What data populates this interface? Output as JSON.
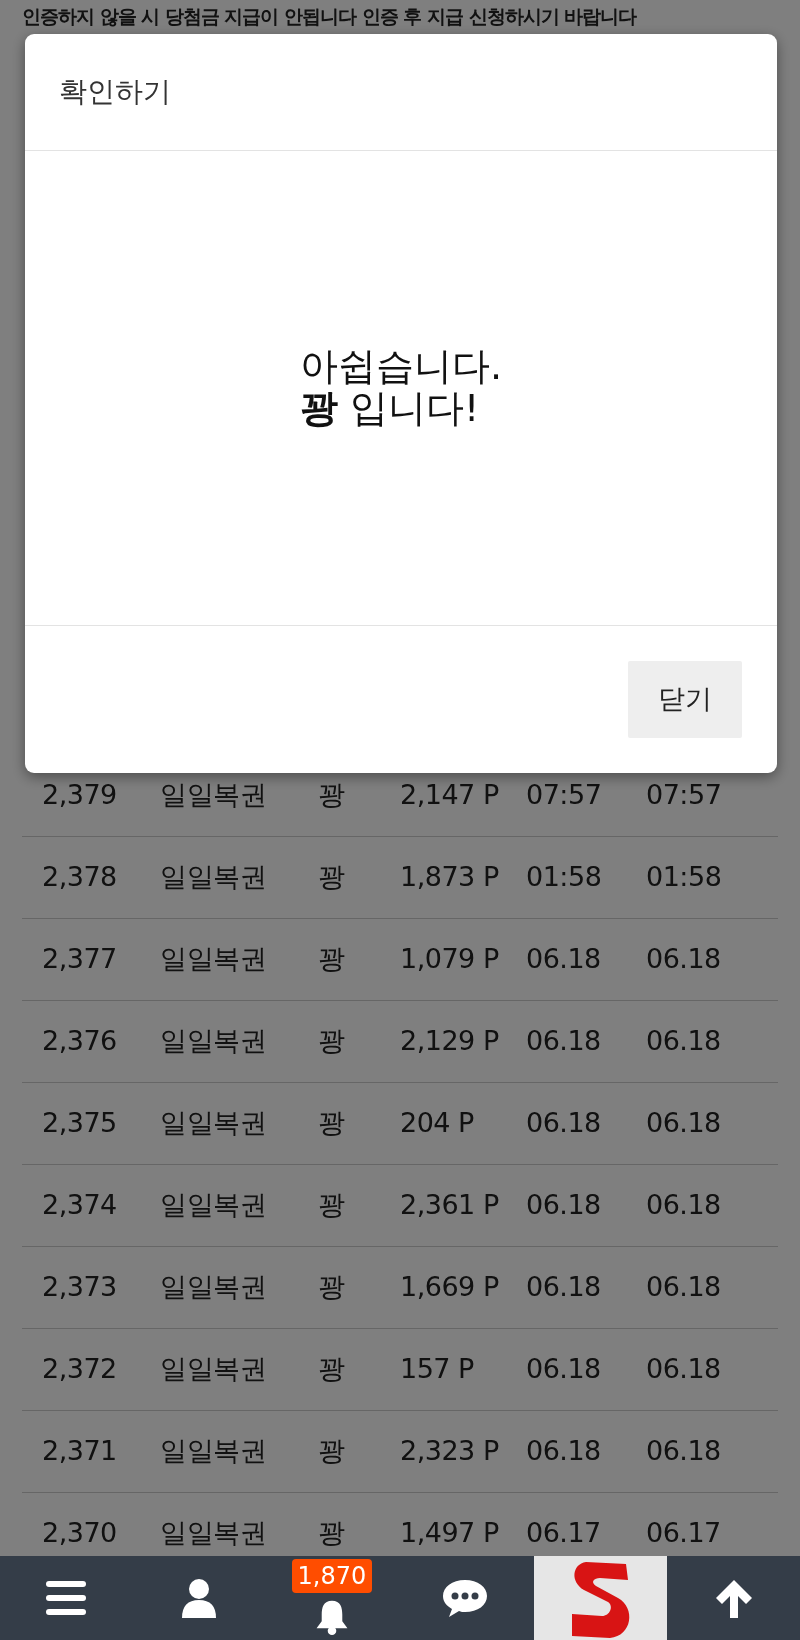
{
  "notice": "인증하지 않을 시 당첨금 지급이 안됩니다 인증 후 지급 신청하시기 바랍니다",
  "modal": {
    "title": "확인하기",
    "message": "아쉽습니다.\n**꽝** 입니다!",
    "close_button": "닫기"
  },
  "table": {
    "rows": [
      [
        "2,379",
        "일일복권",
        "꽝",
        "2,147 P",
        "07:57",
        "07:57"
      ],
      [
        "2,378",
        "일일복권",
        "꽝",
        "1,873 P",
        "01:58",
        "01:58"
      ],
      [
        "2,377",
        "일일복권",
        "꽝",
        "1,079 P",
        "06.18",
        "06.18"
      ],
      [
        "2,376",
        "일일복권",
        "꽝",
        "2,129 P",
        "06.18",
        "06.18"
      ],
      [
        "2,375",
        "일일복권",
        "꽝",
        "204 P",
        "06.18",
        "06.18"
      ],
      [
        "2,374",
        "일일복권",
        "꽝",
        "2,361 P",
        "06.18",
        "06.18"
      ],
      [
        "2,373",
        "일일복권",
        "꽝",
        "1,669 P",
        "06.18",
        "06.18"
      ],
      [
        "2,372",
        "일일복권",
        "꽝",
        "157 P",
        "06.18",
        "06.18"
      ],
      [
        "2,371",
        "일일복권",
        "꽝",
        "2,323 P",
        "06.18",
        "06.18"
      ],
      [
        "2,370",
        "일일복권",
        "꽝",
        "1,497 P",
        "06.17",
        "06.17"
      ]
    ]
  },
  "bottom_nav": {
    "items": [
      {
        "kind": "menu"
      },
      {
        "kind": "user"
      },
      {
        "kind": "bell",
        "badge": "1,870"
      },
      {
        "kind": "chat"
      },
      {
        "kind": "logo"
      },
      {
        "kind": "up"
      }
    ]
  }
}
